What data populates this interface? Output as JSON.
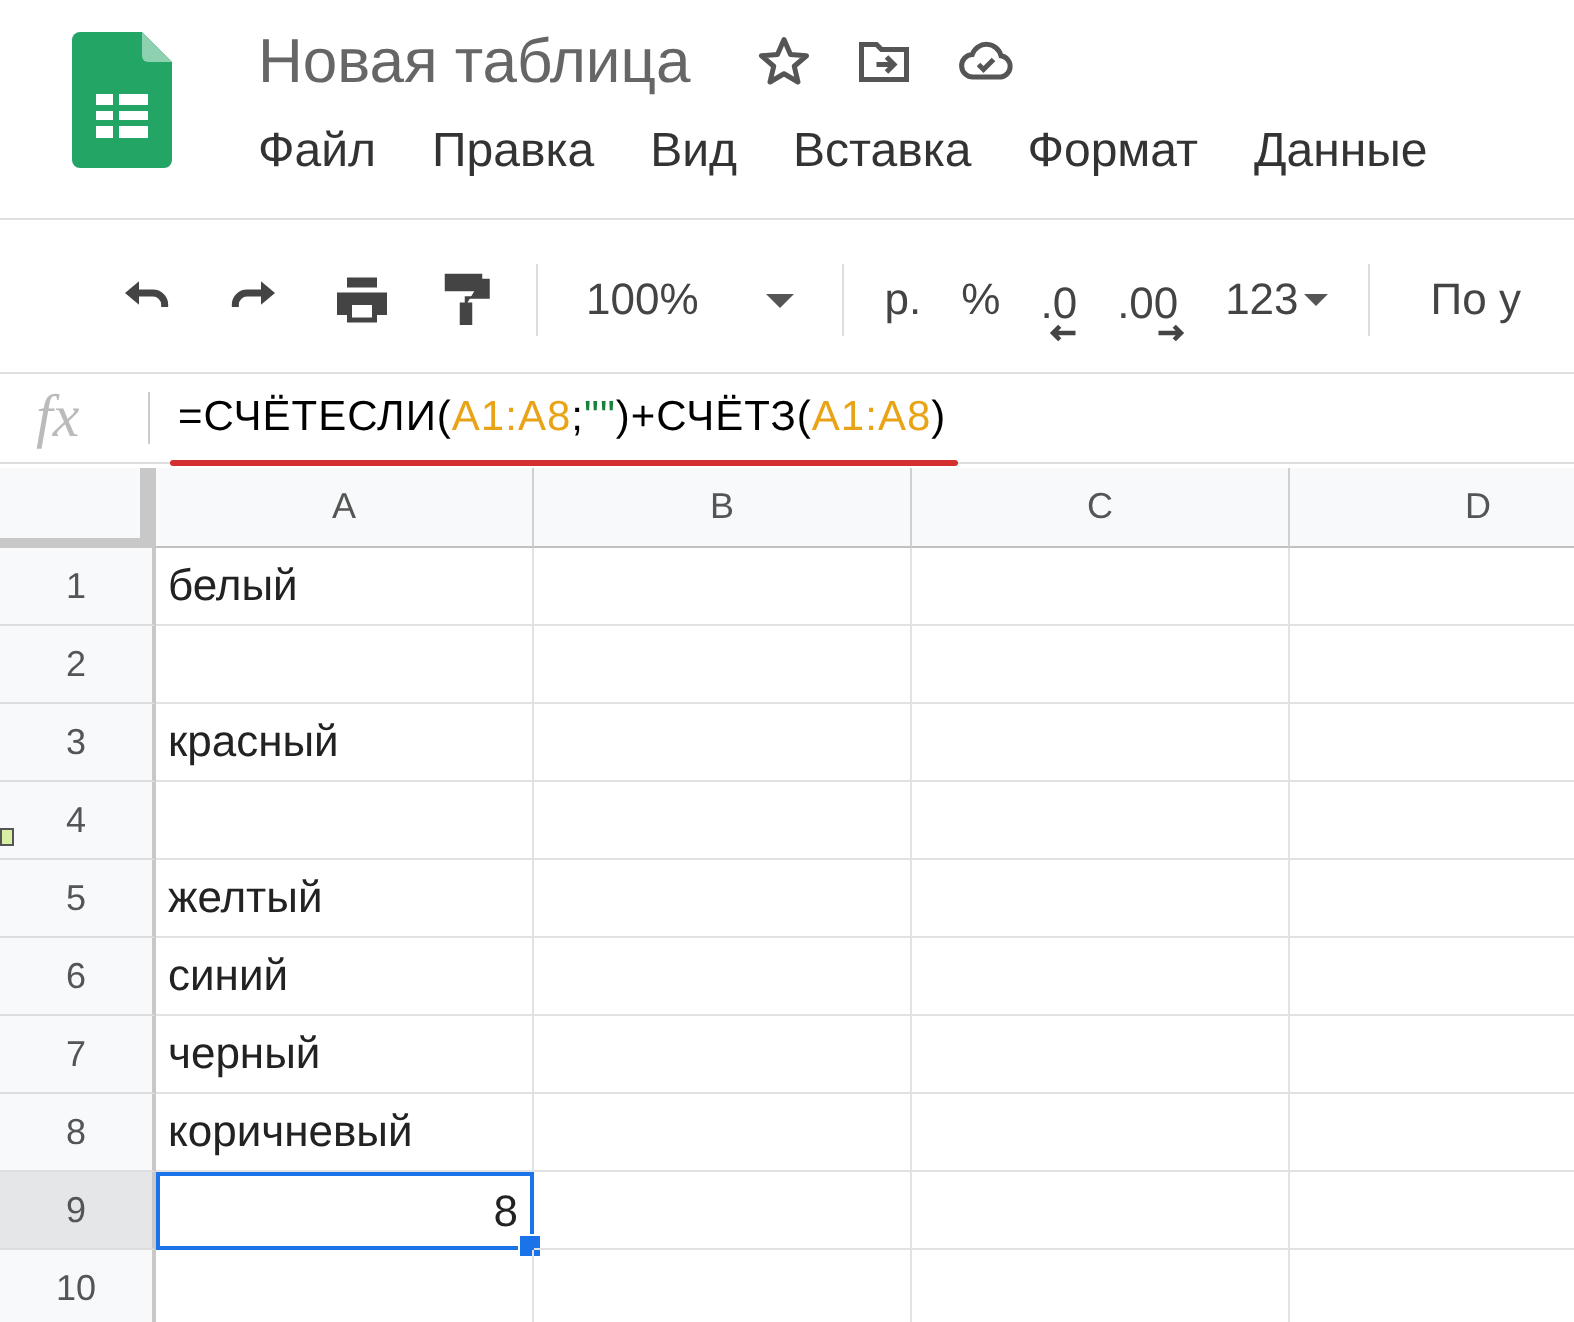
{
  "document": {
    "title": "Новая таблица"
  },
  "menu": [
    "Файл",
    "Правка",
    "Вид",
    "Вставка",
    "Формат",
    "Данные"
  ],
  "toolbar": {
    "zoom": "100%",
    "currency": "р.",
    "percent": "%",
    "decrease_decimals": ".0",
    "increase_decimals": ".00",
    "number_format": "123",
    "font": "По у"
  },
  "formula_bar": {
    "label": "fx",
    "segments": [
      {
        "text": "=СЧЁТЕСЛИ(",
        "kind": "plain"
      },
      {
        "text": "A1:A8",
        "kind": "range"
      },
      {
        "text": ";",
        "kind": "plain"
      },
      {
        "text": "\"\"",
        "kind": "string"
      },
      {
        "text": ")+СЧЁТЗ(",
        "kind": "plain"
      },
      {
        "text": "A1:A8",
        "kind": "range"
      },
      {
        "text": ")",
        "kind": "plain"
      }
    ]
  },
  "columns": [
    "A",
    "B",
    "C",
    "D"
  ],
  "rows": [
    {
      "number": "1",
      "selected": false,
      "cells": [
        "белый",
        "",
        "",
        ""
      ]
    },
    {
      "number": "2",
      "selected": false,
      "cells": [
        "",
        "",
        "",
        ""
      ]
    },
    {
      "number": "3",
      "selected": false,
      "cells": [
        "красный",
        "",
        "",
        ""
      ]
    },
    {
      "number": "4",
      "selected": false,
      "cells": [
        "",
        "",
        "",
        ""
      ]
    },
    {
      "number": "5",
      "selected": false,
      "cells": [
        "желтый",
        "",
        "",
        ""
      ]
    },
    {
      "number": "6",
      "selected": false,
      "cells": [
        "синий",
        "",
        "",
        ""
      ]
    },
    {
      "number": "7",
      "selected": false,
      "cells": [
        "черный",
        "",
        "",
        ""
      ]
    },
    {
      "number": "8",
      "selected": false,
      "cells": [
        "коричневый",
        "",
        "",
        ""
      ]
    },
    {
      "number": "9",
      "selected": true,
      "cells": [
        "8",
        "",
        "",
        ""
      ]
    },
    {
      "number": "10",
      "selected": false,
      "cells": [
        "",
        "",
        "",
        ""
      ]
    }
  ]
}
